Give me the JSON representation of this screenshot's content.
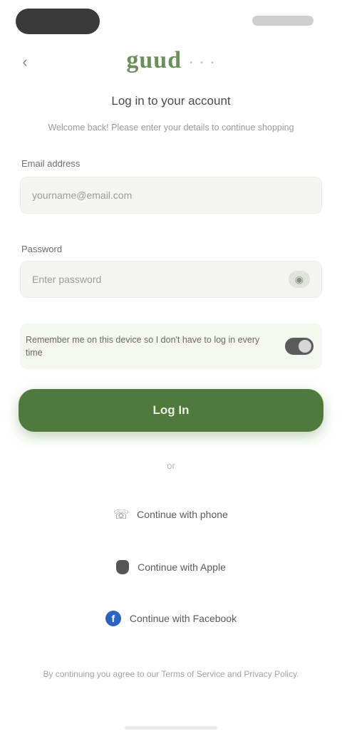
{
  "logo": {
    "main": "guud",
    "accent": "· · ·"
  },
  "header": {
    "back_icon": "chevron-left-icon",
    "subtitle": "Log in to your account",
    "description": "Welcome back! Please enter your details to continue shopping"
  },
  "form": {
    "email_label": "Email address",
    "email_value": "",
    "email_placeholder": "yourname@email.com",
    "password_label": "Password",
    "password_value": "",
    "password_placeholder": "Enter password",
    "show_password_icon": "eye-icon",
    "remember_text": "Remember me on this device so I don't have to log in every time",
    "remember_enabled": true,
    "login_button": "Log In"
  },
  "divider": {
    "label": "or"
  },
  "social": {
    "phone_label": "Continue with phone",
    "phone_icon": "phone-icon",
    "apple_label": "Continue with Apple",
    "apple_icon": "apple-icon",
    "facebook_label": "Continue with Facebook",
    "facebook_icon": "facebook-icon"
  },
  "footer": {
    "terms": "By continuing you agree to our Terms of Service and Privacy Policy."
  },
  "colors": {
    "accent": "#4f7a3c",
    "logo": "#6a8f5a",
    "facebook": "#2c64c4"
  }
}
